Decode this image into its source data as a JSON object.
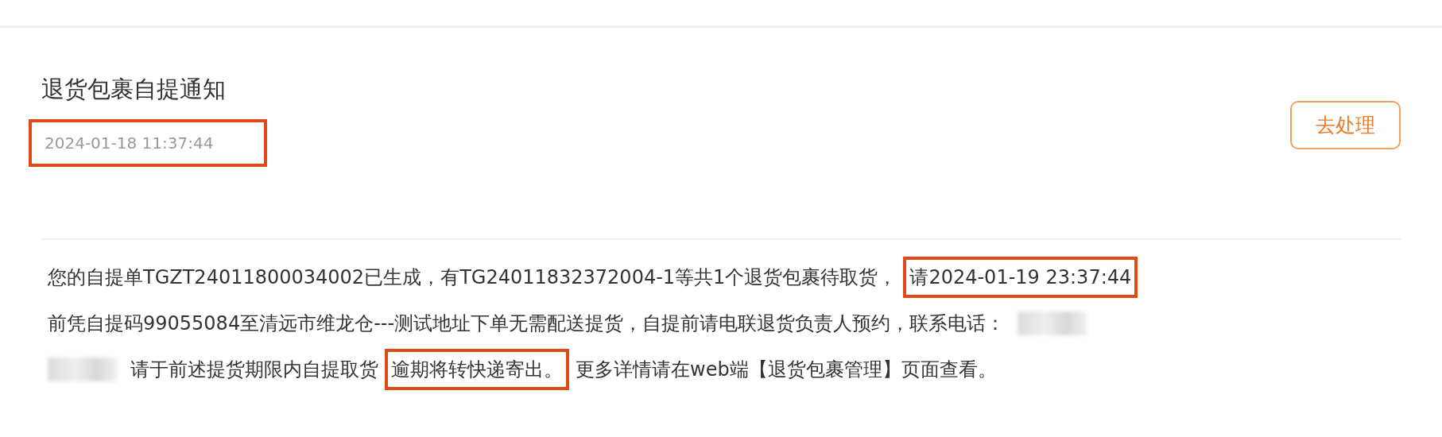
{
  "title": "退货包裹自提通知",
  "time": {
    "text": "2024-01-18 11:37:44",
    "highlighted": true
  },
  "action_button": "去处理",
  "body_lines": [
    [
      {
        "kind": "text",
        "text": "您的自提单TGZT24011800034002已生成，有TG24011832372004-1等共1个退货包裹待取货，",
        "highlighted": false
      },
      {
        "kind": "text",
        "text": "请2024-01-19 23:37:44",
        "highlighted": true
      }
    ],
    [
      {
        "kind": "text",
        "text": "前凭自提码99055084至清远市维龙仓---测试地址下单无需配送提货，自提前请电联退货负责人预约，联系电话：",
        "highlighted": false
      },
      {
        "kind": "redacted",
        "highlighted": false
      }
    ],
    [
      {
        "kind": "redacted",
        "highlighted": false
      },
      {
        "kind": "text",
        "text": "请于前述提货期限内自提取货",
        "highlighted": false
      },
      {
        "kind": "text",
        "text": "逾期将转快递寄出。",
        "highlighted": true
      },
      {
        "kind": "text",
        "text": "更多详情请在web端【退货包裹管理】页面查看。",
        "highlighted": false
      }
    ]
  ]
}
